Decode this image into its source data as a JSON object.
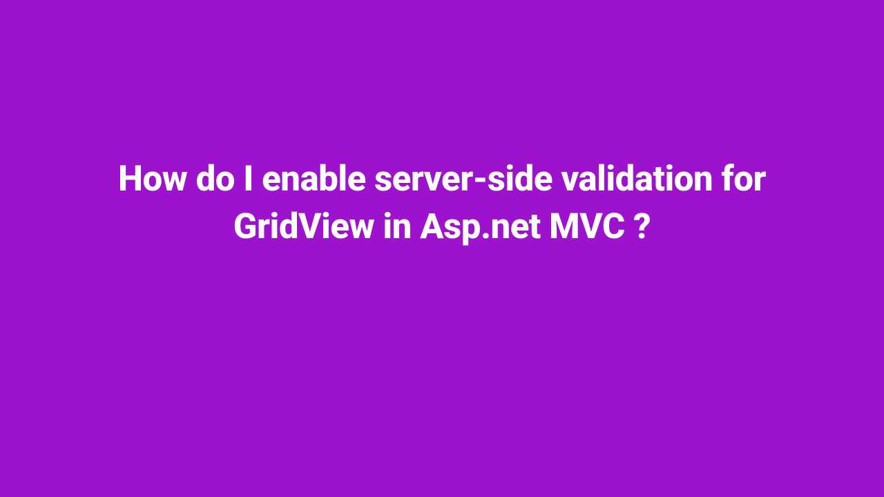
{
  "heading": {
    "text": "How do I enable server-side validation for GridView in Asp.net MVC ?"
  },
  "colors": {
    "background": "#9D12CC",
    "text": "#FFFFFF"
  }
}
